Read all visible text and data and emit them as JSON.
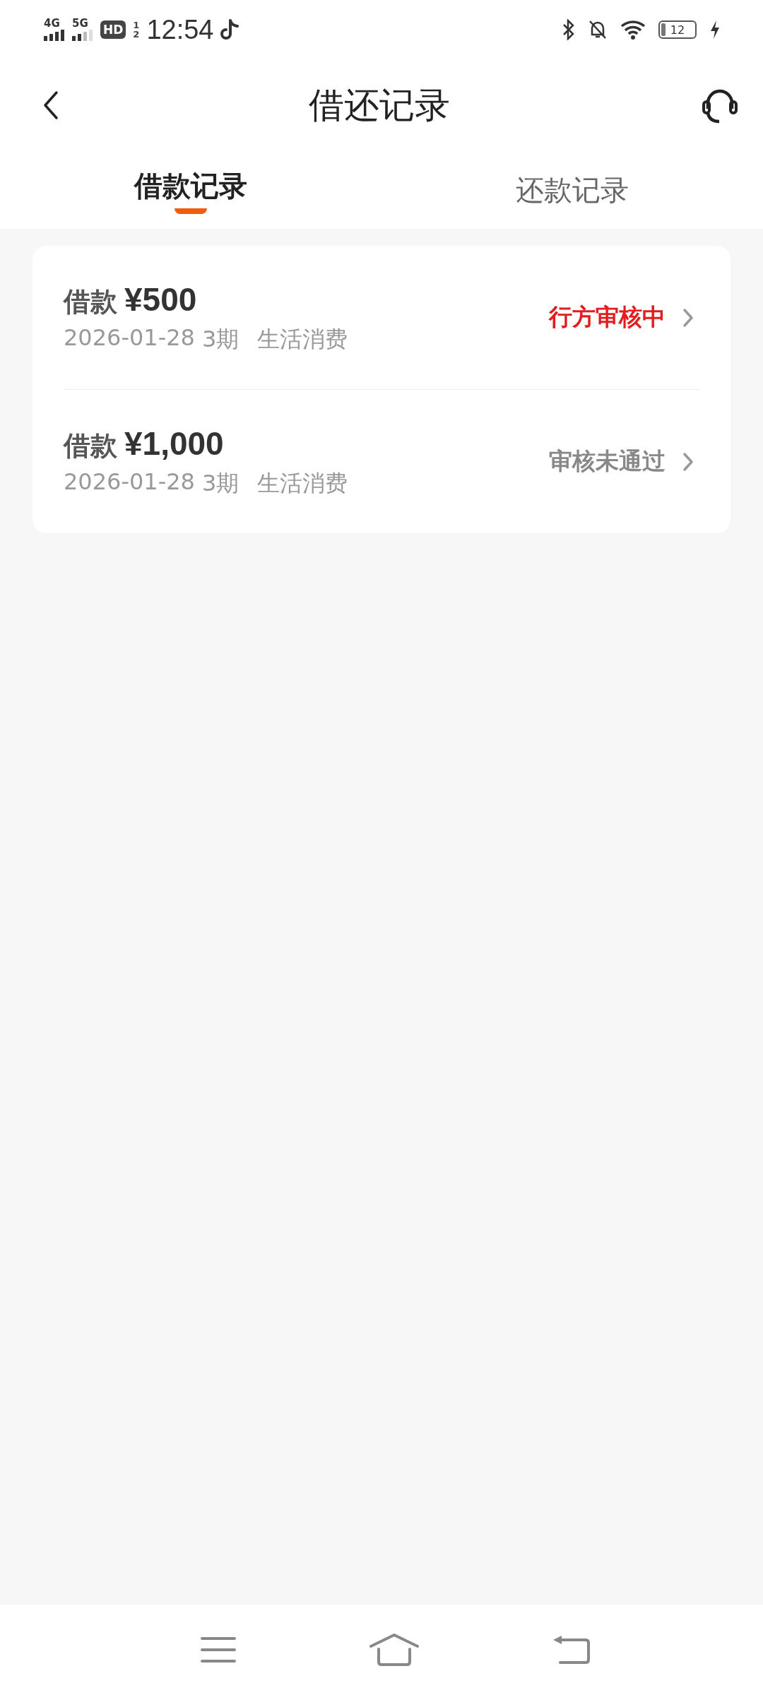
{
  "status_bar": {
    "network_1": "4G",
    "network_2": "5G",
    "hd_badge": "HD",
    "sim": "1",
    "sim_2": "2",
    "time": "12:54",
    "battery": "12"
  },
  "header": {
    "title": "借还记录"
  },
  "tabs": [
    {
      "label": "借款记录",
      "selected": true
    },
    {
      "label": "还款记录",
      "selected": false
    }
  ],
  "records": [
    {
      "label": "借款",
      "amount": "¥500",
      "date": "2026-01-28",
      "term": "3期",
      "purpose": "生活消费",
      "status": "行方审核中",
      "kind": "pending"
    },
    {
      "label": "借款",
      "amount": "¥1,000",
      "date": "2026-01-28",
      "term": "3期",
      "purpose": "生活消费",
      "status": "审核未通过",
      "kind": "rejected"
    }
  ]
}
